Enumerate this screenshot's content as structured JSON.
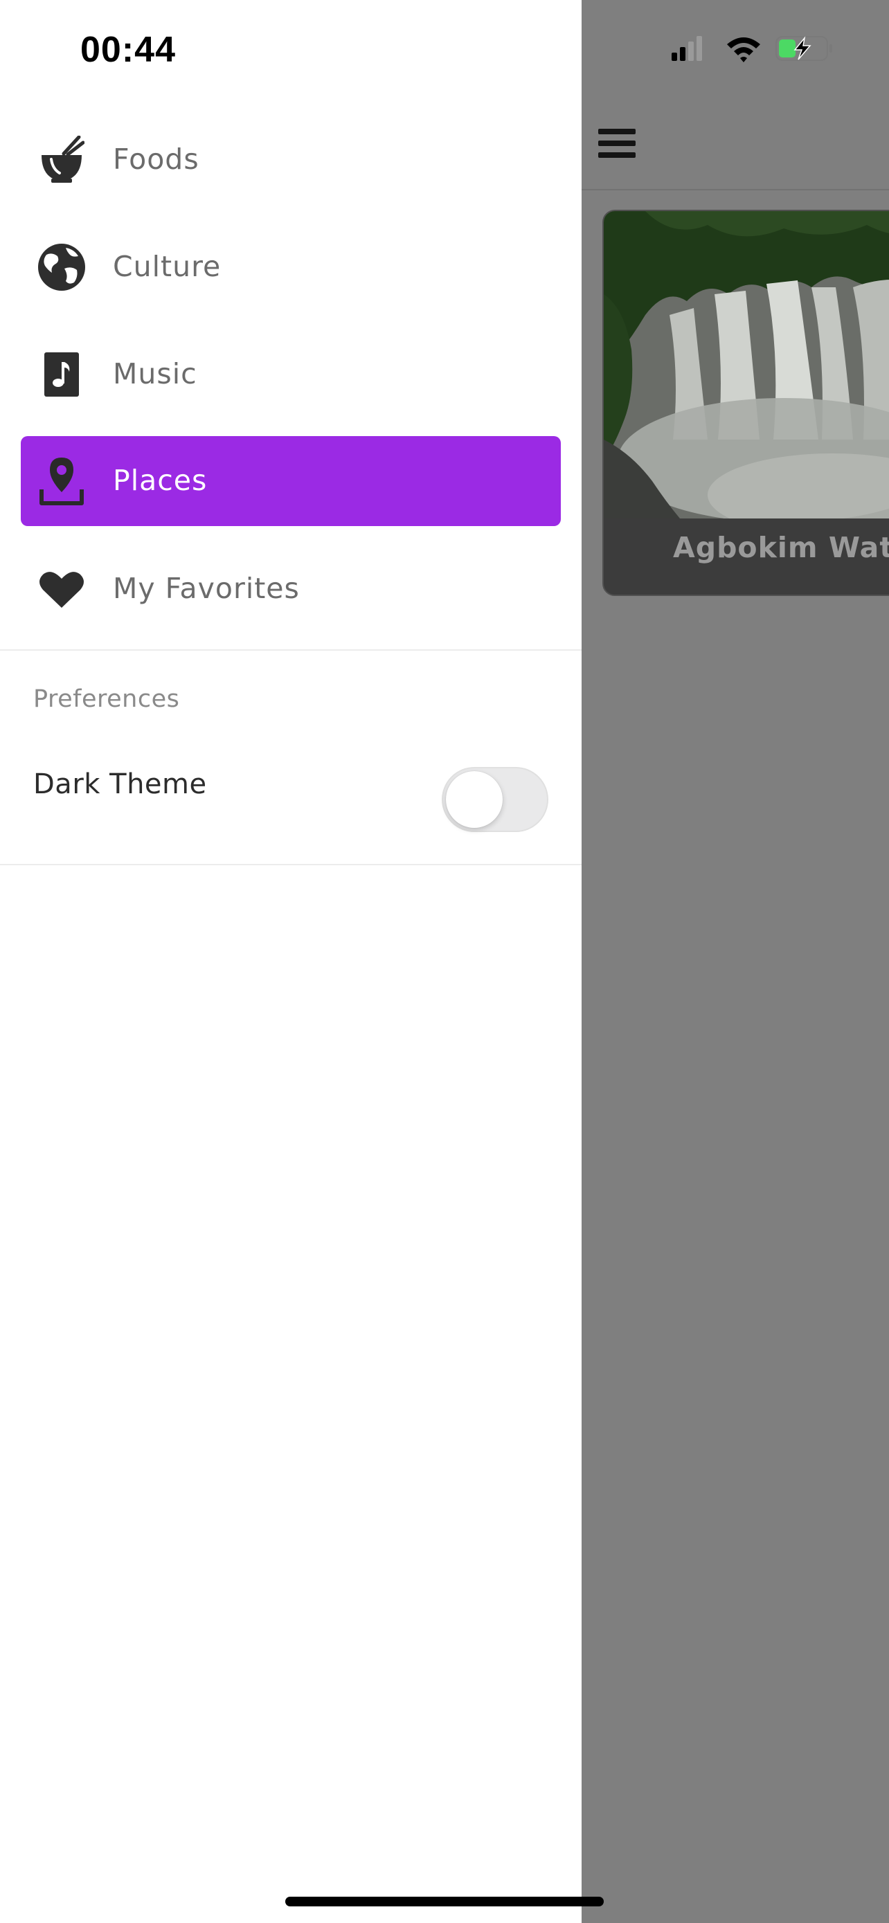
{
  "status_bar": {
    "time": "00:44",
    "icons": [
      "signal-icon",
      "wifi-icon",
      "battery-charging-icon"
    ]
  },
  "drawer": {
    "items": [
      {
        "label": "Foods",
        "icon": "food-bowl-icon",
        "active": false
      },
      {
        "label": "Culture",
        "icon": "globe-icon",
        "active": false
      },
      {
        "label": "Music",
        "icon": "music-note-icon",
        "active": false
      },
      {
        "label": "Places",
        "icon": "map-pin-icon",
        "active": true
      },
      {
        "label": "My Favorites",
        "icon": "heart-icon",
        "active": false
      }
    ],
    "preferences": {
      "heading": "Preferences",
      "dark_theme_label": "Dark Theme",
      "dark_theme_enabled": false
    }
  },
  "background": {
    "menu_icon": "hamburger-menu-icon",
    "card_title": "Agbokim Wate"
  },
  "colors": {
    "accent": "#9b2ae4",
    "overlay": "#7f7f7f",
    "drawer_bg": "#ffffff"
  }
}
